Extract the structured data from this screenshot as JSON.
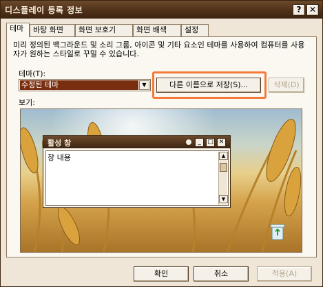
{
  "window": {
    "title": "디스플레이 등록 정보"
  },
  "titlebar_buttons": {
    "help": "?",
    "close": "✕"
  },
  "tabs": [
    {
      "label": "테마",
      "active": true
    },
    {
      "label": "바탕 화면",
      "active": false
    },
    {
      "label": "화면 보호기",
      "active": false
    },
    {
      "label": "화면 배색",
      "active": false
    },
    {
      "label": "설정",
      "active": false
    }
  ],
  "description": "미리 정의된 백그라운드 및 소리 그룹, 아이콘 및 기타 요소인 테마를 사용하여 컴퓨터를 사용자가 원하는 스타일로 꾸밀 수 있습니다.",
  "theme": {
    "label": "테마(T):",
    "selected": "수정된 테마",
    "save_as_label": "다른 이름으로 저장(S)...",
    "delete_label": "삭제(D)"
  },
  "preview": {
    "label": "보기:",
    "inner_window_title": "활성 창",
    "inner_window_text": "창 내용"
  },
  "footer": {
    "ok_label": "확인",
    "cancel_label": "취소",
    "apply_label": "적용(A)"
  },
  "colors": {
    "accent_highlight": "#f57a3a",
    "titlebar": "#4e3018",
    "selection": "#7a2e10"
  }
}
